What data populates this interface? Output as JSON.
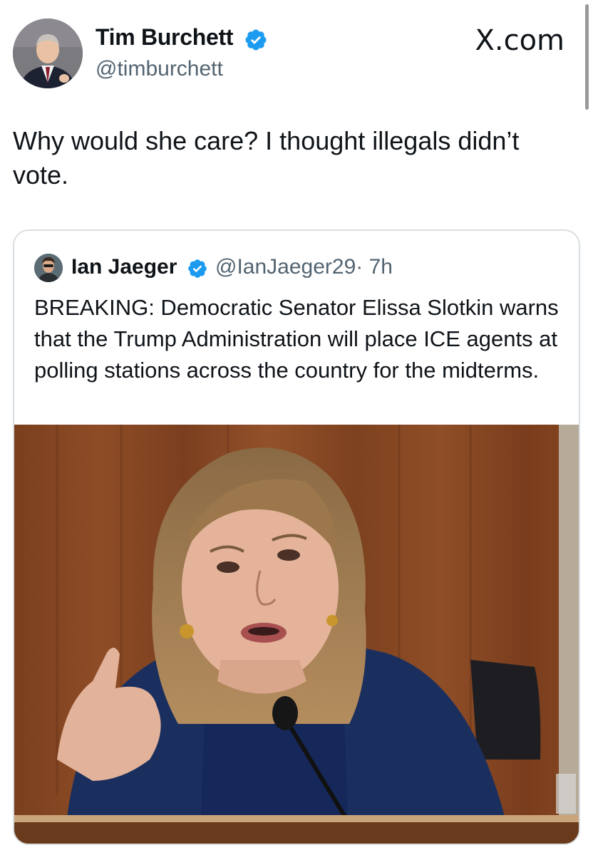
{
  "tweet": {
    "author_name": "Tim Burchett",
    "author_handle": "@timburchett",
    "site": "X.com",
    "text": "Why would she care? I thought illegals didn’t vote."
  },
  "quoted": {
    "author_name": "Ian Jaeger",
    "author_handle": "@IanJaeger29",
    "time": "· 7h",
    "text": "BREAKING: Democratic Senator Elissa Slotkin warns that the Trump Administration will place ICE agents at polling stations across the country for the midterms."
  },
  "colors": {
    "verified": "#1d9bf0",
    "text": "#0f1419",
    "secondary": "#536471"
  },
  "icons": {
    "verified": "verified-badge-icon",
    "avatar": "profile-photo"
  }
}
